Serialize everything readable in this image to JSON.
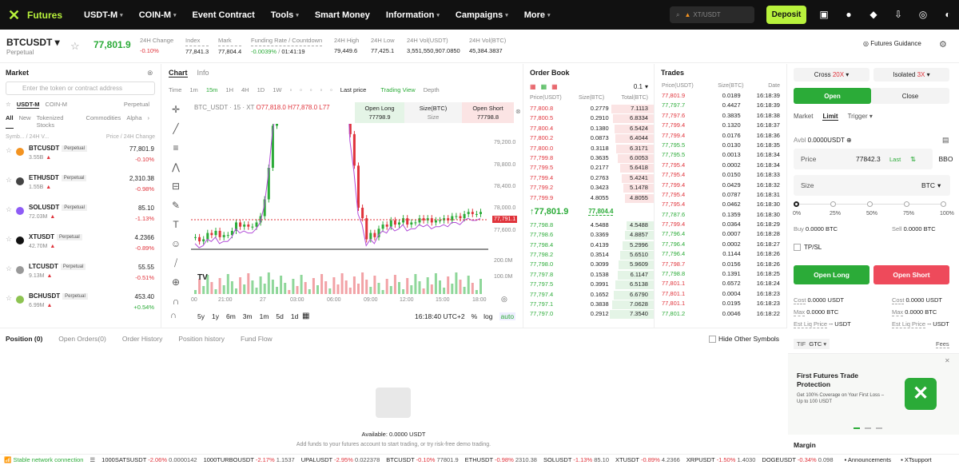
{
  "nav": {
    "brand": "Futures",
    "items": [
      "USDT-M",
      "COIN-M",
      "Event Contract",
      "Tools",
      "Smart Money",
      "Information",
      "Campaigns",
      "More"
    ],
    "search_placeholder": "XT/USDT",
    "deposit": "Deposit"
  },
  "ticker": {
    "symbol": "BTCUSDT",
    "type": "Perpetual",
    "last": "77,801.9",
    "change_label": "24H Change",
    "change": "-0.10%",
    "index_label": "Index",
    "index": "77,841.3",
    "mark_label": "Mark",
    "mark": "77,804.4",
    "funding_label": "Funding Rate / Countdown",
    "funding": "-0.0039%",
    "countdown": "01:41:19",
    "high_label": "24H High",
    "high": "79,449.6",
    "low_label": "24H Low",
    "low": "77,425.1",
    "volu_label": "24H Vol(USDT)",
    "volu": "3,551,550,907.0850",
    "volb_label": "24H Vol(BTC)",
    "volb": "45,384.3837",
    "guidance": "Futures Guidance"
  },
  "market": {
    "title": "Market",
    "search_placeholder": "Enter the token or contract address",
    "tabs1": [
      "USDT-M",
      "COIN-M"
    ],
    "perpetual": "Perpetual",
    "tabs2": [
      "All",
      "New",
      "Tokenized Stocks",
      "Commodities",
      "Alpha"
    ],
    "col1": "Symb... / 24H V...",
    "col2": "Price / 24H Change",
    "rows": [
      {
        "name": "BTCUSDT",
        "tag": "Perpetual",
        "vol": "3.55B",
        "price": "77,801.9",
        "chg": "-0.10%",
        "up": false,
        "color": "#f39321"
      },
      {
        "name": "ETHUSDT",
        "tag": "Perpetual",
        "vol": "1.55B",
        "price": "2,310.38",
        "chg": "-0.98%",
        "up": false,
        "color": "#444"
      },
      {
        "name": "SOLUSDT",
        "tag": "Perpetual",
        "vol": "72.03M",
        "price": "85.10",
        "chg": "-1.13%",
        "up": false,
        "color": "#8e5cf6"
      },
      {
        "name": "XTUSDT",
        "tag": "Perpetual",
        "vol": "42.70M",
        "price": "4.2366",
        "chg": "-0.89%",
        "up": false,
        "color": "#111"
      },
      {
        "name": "LTCUSDT",
        "tag": "Perpetual",
        "vol": "9.13M",
        "price": "55.55",
        "chg": "-0.51%",
        "up": false,
        "color": "#999"
      },
      {
        "name": "BCHUSDT",
        "tag": "Perpetual",
        "vol": "6.99M",
        "price": "453.40",
        "chg": "+0.54%",
        "up": true,
        "color": "#8dc351"
      }
    ]
  },
  "chart": {
    "tabs": [
      "Chart",
      "Info"
    ],
    "intervals": [
      "Time",
      "1m",
      "15m",
      "1H",
      "4H",
      "1D",
      "1W"
    ],
    "last_price": "Last price",
    "trading_view": "Trading View",
    "depth": "Depth",
    "symbol_info": "BTC_USDT · 15 · XT",
    "o": "O77,818.0",
    "h": "H77,878.0",
    "l": "L77",
    "open_long": "Open Long",
    "long_price": "77798.9",
    "size_label": "Size(BTC)",
    "size": "Size",
    "open_short": "Open Short",
    "short_price": "77798.8",
    "y_ticks": [
      "79,200.0",
      "78,800.0",
      "78,400.0",
      "78,000.0",
      "77,600.0"
    ],
    "price_tag": "77,791.1",
    "vol_ticks": [
      "200.0M",
      "100.0M"
    ],
    "x_ticks": [
      "00",
      "21:00",
      "27",
      "03:00",
      "06:00",
      "09:00",
      "12:00",
      "15:00",
      "18:00"
    ],
    "ranges": [
      "5y",
      "1y",
      "6m",
      "3m",
      "1m",
      "5d",
      "1d"
    ],
    "time": "16:18:40 UTC+2",
    "pct": "%",
    "log": "log",
    "auto": "auto"
  },
  "book": {
    "title": "Order Book",
    "step": "0.1",
    "cols": [
      "Price(USDT)",
      "Size(BTC)",
      "Total(BTC)"
    ],
    "asks": [
      [
        "77,800.8",
        "0.2779",
        "7.1113"
      ],
      [
        "77,800.5",
        "0.2910",
        "6.8334"
      ],
      [
        "77,800.4",
        "0.1380",
        "6.5424"
      ],
      [
        "77,800.2",
        "0.0873",
        "6.4044"
      ],
      [
        "77,800.0",
        "0.3118",
        "6.3171"
      ],
      [
        "77,799.8",
        "0.3635",
        "6.0053"
      ],
      [
        "77,799.5",
        "0.2177",
        "5.6418"
      ],
      [
        "77,799.4",
        "0.2763",
        "5.4241"
      ],
      [
        "77,799.2",
        "0.3423",
        "5.1478"
      ],
      [
        "77,799.9",
        "4.8055",
        "4.8055"
      ]
    ],
    "mid": "↑77,801.9",
    "mark": "77,804.4",
    "bids": [
      [
        "77,798.8",
        "4.5488",
        "4.5488"
      ],
      [
        "77,798.6",
        "0.3369",
        "4.8857"
      ],
      [
        "77,798.4",
        "0.4139",
        "5.2996"
      ],
      [
        "77,798.2",
        "0.3514",
        "5.6510"
      ],
      [
        "77,798.0",
        "0.3099",
        "5.9609"
      ],
      [
        "77,797.8",
        "0.1538",
        "6.1147"
      ],
      [
        "77,797.5",
        "0.3991",
        "6.5138"
      ],
      [
        "77,797.4",
        "0.1652",
        "6.6790"
      ],
      [
        "77,797.1",
        "0.3838",
        "7.0628"
      ],
      [
        "77,797.0",
        "0.2912",
        "7.3540"
      ]
    ]
  },
  "trades": {
    "title": "Trades",
    "cols": [
      "Price(USDT)",
      "Size(BTC)",
      "Date"
    ],
    "rows": [
      [
        "77,801.9",
        "0.0189",
        "16:18:39",
        false
      ],
      [
        "77,797.7",
        "0.4427",
        "16:18:39",
        true
      ],
      [
        "77,797.6",
        "0.3835",
        "16:18:38",
        false
      ],
      [
        "77,799.4",
        "0.1320",
        "16:18:37",
        false
      ],
      [
        "77,799.4",
        "0.0176",
        "16:18:36",
        false
      ],
      [
        "77,795.5",
        "0.0130",
        "16:18:35",
        true
      ],
      [
        "77,795.5",
        "0.0013",
        "16:18:34",
        true
      ],
      [
        "77,795.4",
        "0.0002",
        "16:18:34",
        false
      ],
      [
        "77,795.4",
        "0.0150",
        "16:18:33",
        false
      ],
      [
        "77,799.4",
        "0.0429",
        "16:18:32",
        false
      ],
      [
        "77,795.4",
        "0.0787",
        "16:18:31",
        false
      ],
      [
        "77,795.4",
        "0.0462",
        "16:18:30",
        false
      ],
      [
        "77,787.6",
        "0.1359",
        "16:18:30",
        true
      ],
      [
        "77,799.4",
        "0.0364",
        "16:18:29",
        false
      ],
      [
        "77,796.4",
        "0.0007",
        "16:18:28",
        true
      ],
      [
        "77,796.4",
        "0.0002",
        "16:18:27",
        true
      ],
      [
        "77,796.4",
        "0.1144",
        "16:18:26",
        true
      ],
      [
        "77,798.7",
        "0.0156",
        "16:18:26",
        false
      ],
      [
        "77,798.8",
        "0.1391",
        "16:18:25",
        true
      ],
      [
        "77,801.1",
        "0.6572",
        "16:18:24",
        false
      ],
      [
        "77,801.1",
        "0.0004",
        "16:18:23",
        false
      ],
      [
        "77,801.1",
        "0.0195",
        "16:18:23",
        false
      ],
      [
        "77,801.2",
        "0.0046",
        "16:18:22",
        true
      ]
    ]
  },
  "order": {
    "cross": "Cross",
    "cross_lev": "20X",
    "isolated": "Isolated",
    "iso_lev": "3X",
    "open": "Open",
    "close": "Close",
    "types": [
      "Market",
      "Limit",
      "Trigger"
    ],
    "avbl_label": "Avbl",
    "avbl": "0.0000USDT",
    "price_label": "Price",
    "price": "77842.3",
    "last": "Last",
    "bbo": "BBO",
    "size_label": "Size",
    "size_unit": "BTC",
    "pcts": [
      "0%",
      "25%",
      "50%",
      "75%",
      "100%"
    ],
    "buy_label": "Buy",
    "buy": "0.0000 BTC",
    "sell_label": "Sell",
    "sell": "0.0000 BTC",
    "tpsl": "TP/SL",
    "open_long": "Open Long",
    "open_short": "Open Short",
    "cost": "Cost",
    "cost_l": "0.0000 USDT",
    "cost_s": "0.0000 USDT",
    "max": "Max",
    "max_l": "0.0000 BTC",
    "max_s": "0.0000 BTC",
    "liq": "Est Liq Price",
    "liq_v": "-- USDT",
    "tif": "TIF",
    "gtc": "GTC",
    "fees": "Fees",
    "promo_title": "First Futures Trade Protection",
    "promo_text": "Get 100% Coverage on Your First Loss – Up to 100 USDT",
    "margin": "Margin"
  },
  "positions": {
    "tabs": [
      "Position (0)",
      "Open Orders(0)",
      "Order History",
      "Position history",
      "Fund Flow"
    ],
    "hide": "Hide Other Symbols",
    "avail": "Available: 0.0000 USDT",
    "hint": "Add funds to your futures account to start trading, or try risk-free demo trading."
  },
  "footer": {
    "status": "Stable network connection",
    "items": [
      [
        "1000SATSUSDT",
        "-2.06%",
        "0.0000142"
      ],
      [
        "1000TURBOUSDT",
        "-2.17%",
        "1.1537"
      ],
      [
        "UPALUSDT",
        "-2.95%",
        "0.022378"
      ],
      [
        "BTCUSDT",
        "-0.10%",
        "77801.9"
      ],
      [
        "ETHUSDT",
        "-0.98%",
        "2310.38"
      ],
      [
        "SOLUSDT",
        "-1.13%",
        "85.10"
      ],
      [
        "XTUSDT",
        "-0.89%",
        "4.2366"
      ],
      [
        "XRPUSDT",
        "-1.50%",
        "1.4030"
      ],
      [
        "DOGEUSDT",
        "-0.34%",
        "0.098"
      ]
    ],
    "ann": "Announcements",
    "support": "XTsupport"
  }
}
